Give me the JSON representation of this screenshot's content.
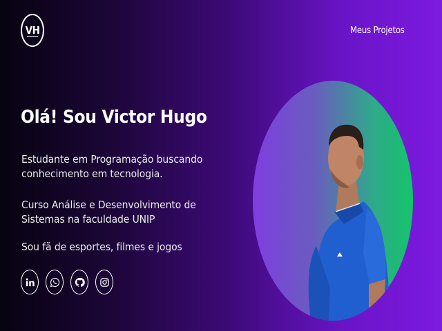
{
  "header": {
    "logo_text": "VH",
    "nav": {
      "projects_label": "Meus Projetos"
    }
  },
  "hero": {
    "title": "Olá! Sou Victor Hugo",
    "paragraphs": [
      "Estudante em Programação buscando conhecimento em tecnologia.",
      "Curso Análise e Desenvolvimento de Sistemas na faculdade UNIP",
      "Sou fã de esportes, filmes e jogos"
    ]
  },
  "socials": [
    {
      "icon": "linkedin-icon"
    },
    {
      "icon": "whatsapp-icon"
    },
    {
      "icon": "github-icon"
    },
    {
      "icon": "instagram-icon"
    }
  ],
  "colors": {
    "background_start": "#070310",
    "background_end": "#7d1adf",
    "photo_gradient_start": "#7f3ee0",
    "photo_gradient_end": "#14c46a",
    "shirt": "#1f5fd0",
    "text": "#ffffff"
  }
}
